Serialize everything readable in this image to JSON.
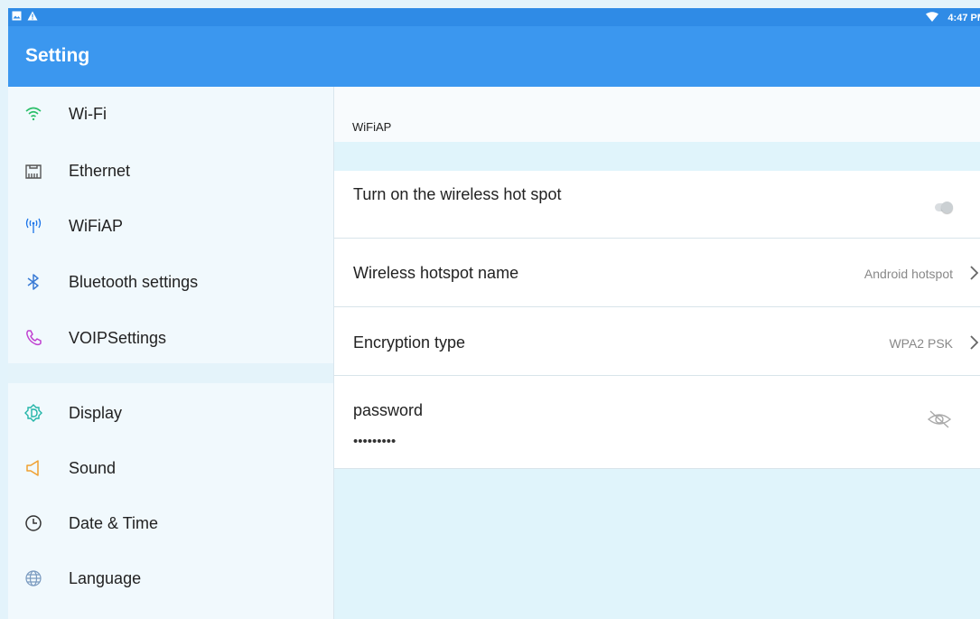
{
  "status_bar": {
    "time": "4:47 PM",
    "left_icons": [
      "image-icon",
      "warning-icon"
    ],
    "right_icons": [
      "wifi-signal-icon"
    ]
  },
  "app_bar": {
    "title": "Setting"
  },
  "sidebar": {
    "items": [
      {
        "label": "Wi-Fi",
        "icon": "wifi-icon",
        "color": "#2bbf6a"
      },
      {
        "label": "Ethernet",
        "icon": "ethernet-icon",
        "color": "#555555"
      },
      {
        "label": "WiFiAP",
        "icon": "hotspot-icon",
        "color": "#1a73e8"
      },
      {
        "label": "Bluetooth settings",
        "icon": "bluetooth-icon",
        "color": "#3a7bd5"
      },
      {
        "label": "VOIPSettings",
        "icon": "phone-icon",
        "color": "#c040d0"
      },
      {
        "label": "Display",
        "icon": "display-icon",
        "color": "#22b5a8"
      },
      {
        "label": "Sound",
        "icon": "sound-icon",
        "color": "#f0a030"
      },
      {
        "label": "Date & Time",
        "icon": "clock-icon",
        "color": "#333333"
      },
      {
        "label": "Language",
        "icon": "globe-icon",
        "color": "#7a9abf"
      }
    ]
  },
  "main": {
    "header": "WiFiAP",
    "rows": {
      "hotspot_toggle": {
        "label": "Turn on the wireless hot spot",
        "on": false
      },
      "hotspot_name": {
        "label": "Wireless hotspot name",
        "value": "Android hotspot"
      },
      "encryption": {
        "label": "Encryption type",
        "value": "WPA2 PSK"
      },
      "password": {
        "label": "password",
        "value": "•••••••••"
      }
    }
  },
  "colors": {
    "status_bar": "#2f8be6",
    "app_bar": "#3b97ef",
    "sidebar_bg": "#f1f9fd",
    "content_bg": "#e0f4fb"
  }
}
